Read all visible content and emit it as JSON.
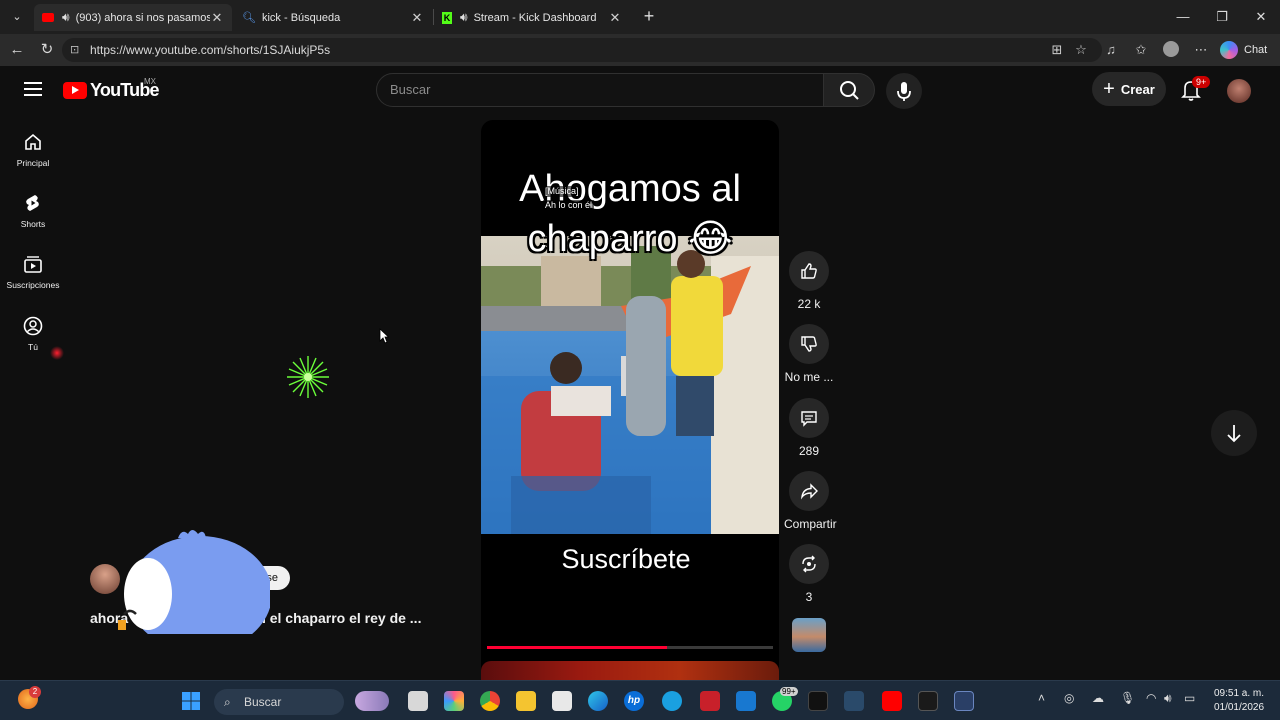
{
  "browser": {
    "tabs": [
      {
        "title": "(903) ahora si nos pasamos c",
        "active": true
      },
      {
        "title": "kick - Búsqueda",
        "active": false
      },
      {
        "title": "Stream - Kick Dashboard",
        "active": false
      }
    ],
    "url": "https://www.youtube.com/shorts/1SJAiukjP5s",
    "chat_label": "Chat"
  },
  "youtube": {
    "logo_text": "YouTube",
    "country_code": "MX",
    "search_placeholder": "Buscar",
    "create_label": "Crear",
    "notification_badge": "9+",
    "sidebar": [
      {
        "label": "Principal",
        "icon": "home-icon"
      },
      {
        "label": "Shorts",
        "icon": "shorts-icon"
      },
      {
        "label": "Suscripciones",
        "icon": "subscriptions-icon"
      },
      {
        "label": "Tú",
        "icon": "you-icon"
      }
    ]
  },
  "short": {
    "title_line1": "Ahogamos al",
    "title_line2": "chaparro 😂",
    "caption_line1": "[Música]",
    "caption_line2": "Ah lo con él",
    "overlay_text": "Suscríbete",
    "progress": 0.63,
    "actions": {
      "likes": "22 k",
      "dislike_label": "No me ...",
      "comments": "289",
      "share_label": "Compartir",
      "remix_count": "3"
    },
    "channel_title": "ahora si nos pasamos con el chaparro el rey de ...",
    "subscribe_partial": "se"
  },
  "taskbar": {
    "search_label": "Buscar",
    "time": "09:51 a. m.",
    "date": "01/01/2026",
    "weather_badge": "2",
    "whatsapp_badge": "99+"
  }
}
